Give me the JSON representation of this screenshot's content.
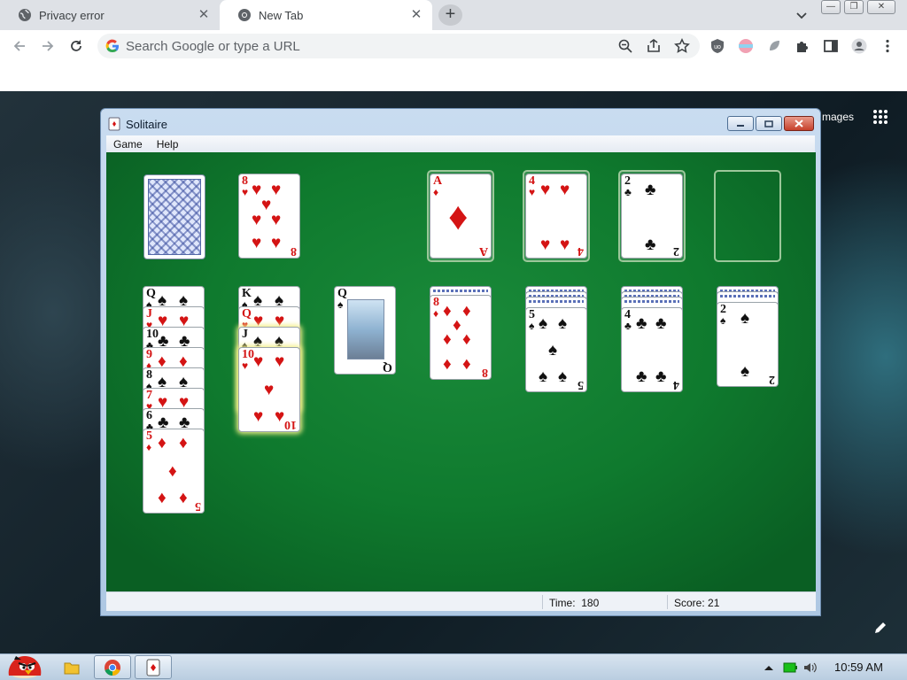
{
  "browser": {
    "tabs": [
      {
        "title": "Privacy error",
        "active": false
      },
      {
        "title": "New Tab",
        "active": true
      }
    ],
    "omnibox": {
      "placeholder": "Search Google or type a URL",
      "value": ""
    }
  },
  "ntp": {
    "images_link": "mages"
  },
  "solitaire": {
    "title": "Solitaire",
    "menu": [
      "Game",
      "Help"
    ],
    "status": {
      "time_label": "Time:",
      "time_value": "180",
      "score_label": "Score:",
      "score_value": "21"
    },
    "stock": {
      "face": "back"
    },
    "waste": {
      "rank": "8",
      "suit": "♥",
      "color": "red"
    },
    "foundations": [
      {
        "rank": "A",
        "suit": "♦",
        "color": "red"
      },
      {
        "rank": "4",
        "suit": "♥",
        "color": "red"
      },
      {
        "rank": "2",
        "suit": "♣",
        "color": "black"
      },
      {
        "rank": "",
        "suit": "",
        "color": ""
      }
    ],
    "tableau": [
      {
        "cards": [
          {
            "rank": "Q",
            "suit": "♠",
            "color": "black"
          },
          {
            "rank": "J",
            "suit": "♥",
            "color": "red"
          },
          {
            "rank": "10",
            "suit": "♣",
            "color": "black"
          },
          {
            "rank": "9",
            "suit": "♦",
            "color": "red"
          },
          {
            "rank": "8",
            "suit": "♠",
            "color": "black"
          },
          {
            "rank": "7",
            "suit": "♥",
            "color": "red"
          },
          {
            "rank": "6",
            "suit": "♣",
            "color": "black"
          },
          {
            "rank": "5",
            "suit": "♦",
            "color": "red"
          }
        ]
      },
      {
        "cards": [
          {
            "rank": "K",
            "suit": "♠",
            "color": "black"
          },
          {
            "rank": "Q",
            "suit": "♥",
            "color": "red"
          },
          {
            "rank": "J",
            "suit": "♠",
            "color": "black"
          },
          {
            "rank": "10",
            "suit": "♥",
            "color": "red"
          }
        ]
      },
      {
        "cards": [
          {
            "rank": "Q",
            "suit": "♠",
            "color": "black"
          }
        ]
      },
      {
        "hidden": 1,
        "cards": [
          {
            "rank": "8",
            "suit": "♦",
            "color": "red"
          }
        ]
      },
      {
        "hidden": 3,
        "cards": [
          {
            "rank": "5",
            "suit": "♠",
            "color": "black"
          }
        ]
      },
      {
        "hidden": 3,
        "cards": [
          {
            "rank": "4",
            "suit": "♣",
            "color": "black"
          }
        ]
      },
      {
        "hidden": 2,
        "cards": [
          {
            "rank": "2",
            "suit": "♠",
            "color": "black"
          }
        ]
      }
    ]
  },
  "taskbar": {
    "clock": "10:59 AM"
  },
  "colors": {
    "felt": "#0f7a2e",
    "red_suit": "#d41414",
    "chrome_tabstrip": "#dee1e6"
  }
}
